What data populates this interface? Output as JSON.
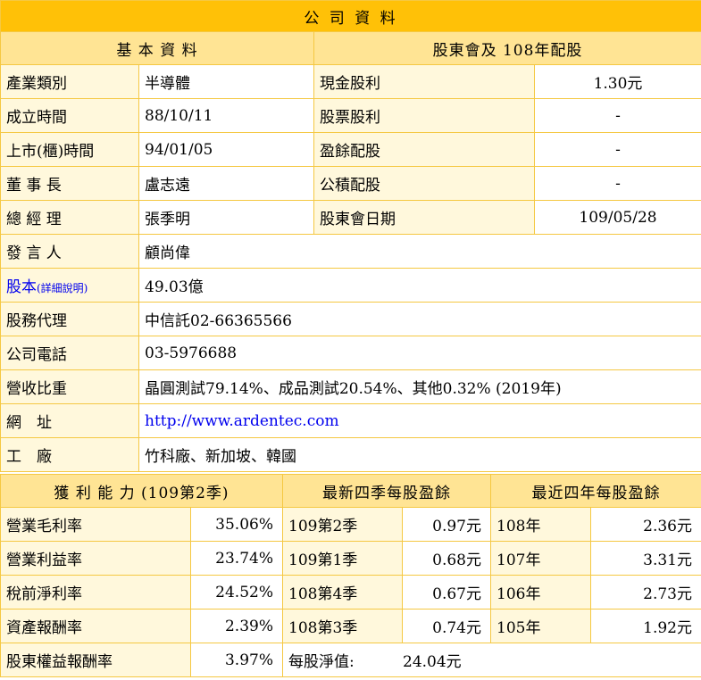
{
  "title": "公 司 資 料",
  "basic_header": "基 本 資 料",
  "dividend_header": "股東會及 108年配股",
  "rows": [
    {
      "label": "產業類別",
      "value": "半導體",
      "label2": "現金股利",
      "value2": "1.30元"
    },
    {
      "label": "成立時間",
      "value": "88/10/11",
      "label2": "股票股利",
      "value2": "-"
    },
    {
      "label": "上市(櫃)時間",
      "value": "94/01/05",
      "label2": "盈餘配股",
      "value2": "-"
    },
    {
      "label": "董 事 長",
      "value": "盧志遠",
      "label2": "公積配股",
      "value2": "-"
    },
    {
      "label": "總 經 理",
      "value": "張季明",
      "label2": "股東會日期",
      "value2": "109/05/28"
    }
  ],
  "spokesperson": {
    "label": "發 言 人",
    "value": "顧尚偉"
  },
  "capital": {
    "label": "股本",
    "link_text": "(詳細說明)",
    "value": "49.03億"
  },
  "transfer_agent": {
    "label": "股務代理",
    "value": "中信託02-66365566"
  },
  "phone": {
    "label": "公司電話",
    "value": "03-5976688"
  },
  "revenue_mix": {
    "label": "營收比重",
    "value": "晶圓測試79.14%、成品測試20.54%、其他0.32% (2019年)"
  },
  "website": {
    "label": "網　址",
    "value": "http://www.ardentec.com"
  },
  "factory": {
    "label": "工　廠",
    "value": "竹科廠、新加坡、韓國"
  },
  "profit_header": "獲 利 能 力 (109第2季)",
  "eps4q_header": "最新四季每股盈餘",
  "eps4y_header": "最近四年每股盈餘",
  "profit_rows": [
    {
      "label": "營業毛利率",
      "value": "35.06%",
      "q": "109第2季",
      "q_eps": "0.97元",
      "y": "108年",
      "y_eps": "2.36元"
    },
    {
      "label": "營業利益率",
      "value": "23.74%",
      "q": "109第1季",
      "q_eps": "0.68元",
      "y": "107年",
      "y_eps": "3.31元"
    },
    {
      "label": "稅前淨利率",
      "value": "24.52%",
      "q": "108第4季",
      "q_eps": "0.67元",
      "y": "106年",
      "y_eps": "2.73元"
    },
    {
      "label": "資產報酬率",
      "value": "2.39%",
      "q": "108第3季",
      "q_eps": "0.74元",
      "y": "105年",
      "y_eps": "1.92元"
    }
  ],
  "roe": {
    "label": "股東權益報酬率",
    "value": "3.97%"
  },
  "nav": {
    "label": "每股淨值:",
    "value": "24.04元"
  }
}
